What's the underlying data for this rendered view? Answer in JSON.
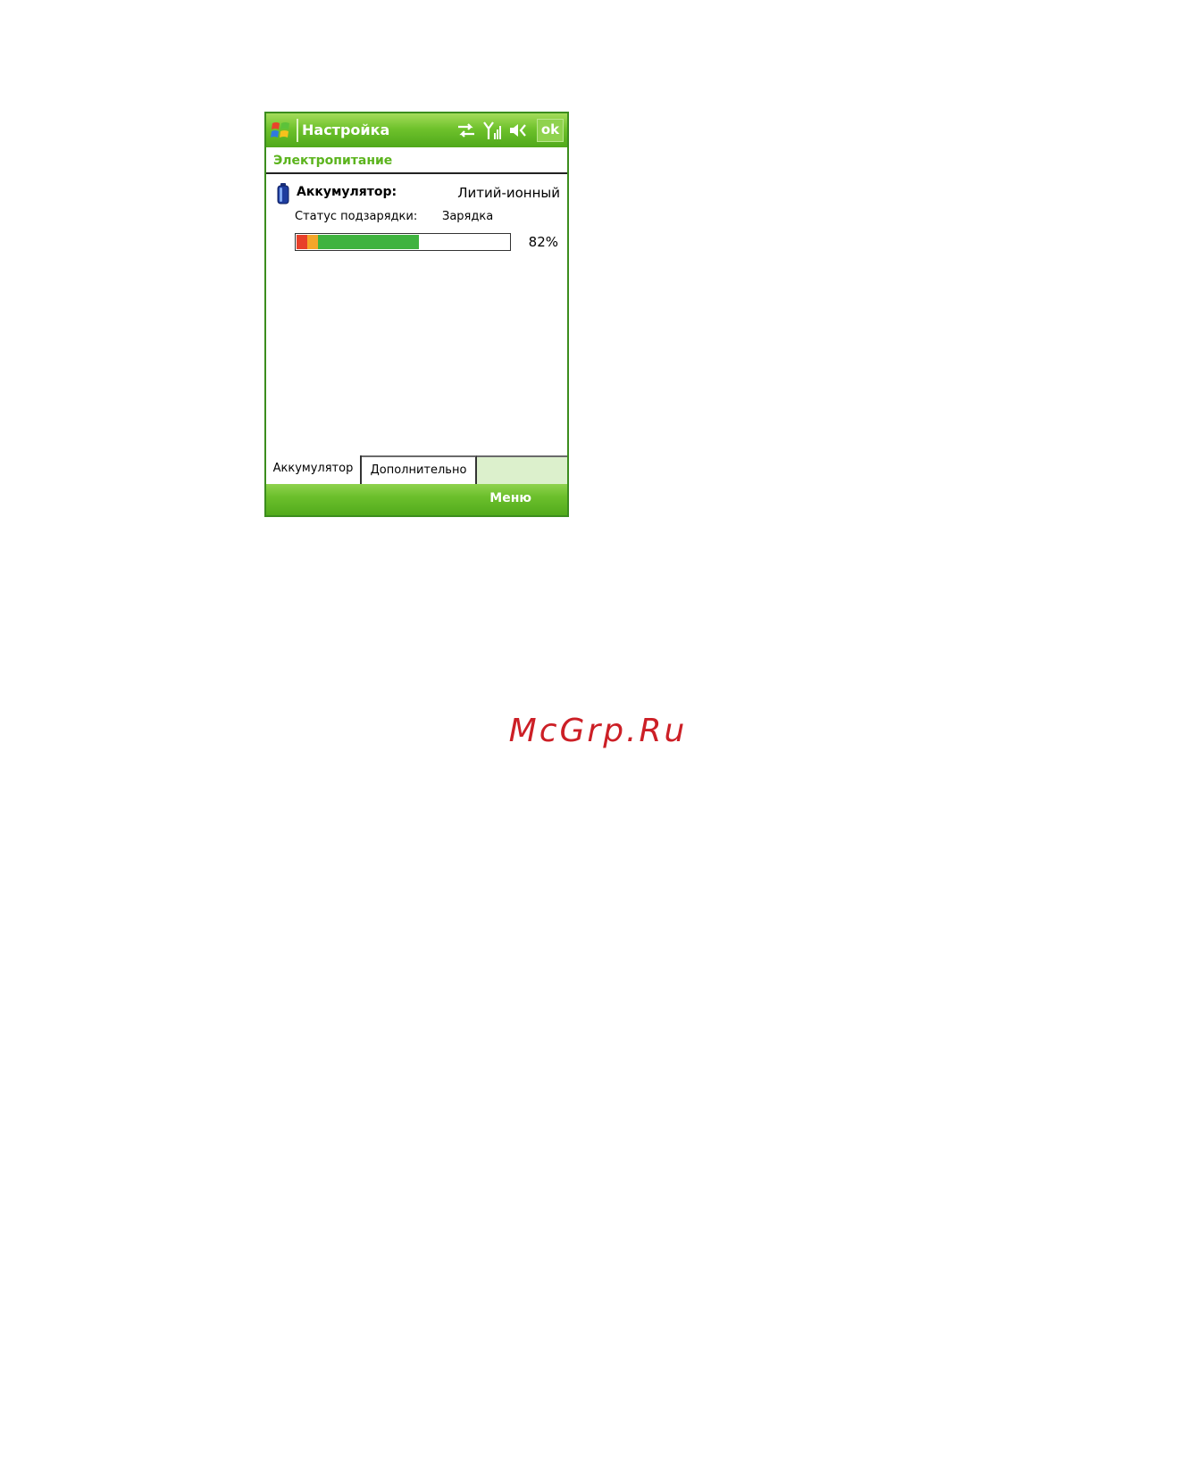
{
  "window": {
    "title": "Настройка",
    "ok_label": "ok"
  },
  "status_icons": [
    "sync-icon",
    "signal-icon",
    "volume-icon"
  ],
  "section": {
    "title": "Электропитание"
  },
  "battery": {
    "label": "Аккумулятор:",
    "type": "Литий-ионный",
    "charge_status_label": "Статус подзарядки:",
    "charge_status_value": "Зарядка",
    "level_percent": 82,
    "level_text": "82%"
  },
  "tabs": [
    {
      "label": "Аккумулятор",
      "active": true
    },
    {
      "label": "Дополнительно",
      "active": false
    }
  ],
  "softkeys": {
    "right": "Меню"
  },
  "watermark": "McGrp.Ru",
  "colors": {
    "accent_green": "#6fc22c",
    "section_title": "#5cb41e",
    "progress_green": "#3fb33f",
    "progress_red": "#e8402a",
    "progress_orange": "#f4a62a",
    "watermark_red": "#cc1f26"
  }
}
